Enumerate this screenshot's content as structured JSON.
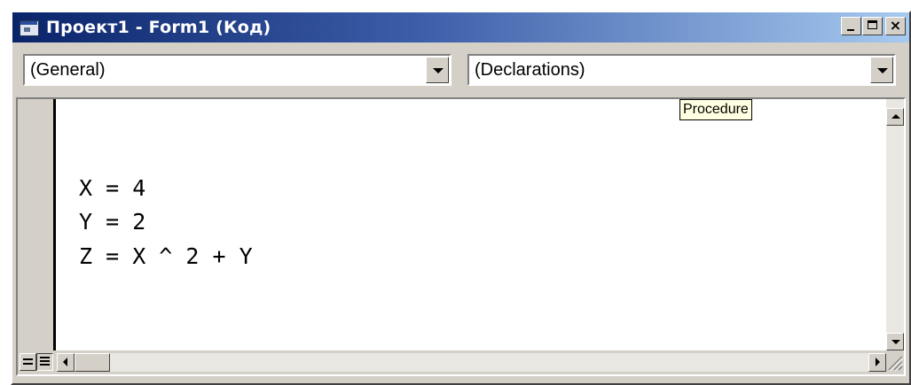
{
  "window": {
    "title": "Проект1 - Form1 (Код)",
    "icons": {
      "app": "vb-form-icon",
      "minimize": "minimize-icon",
      "maximize": "maximize-icon",
      "close": "close-icon"
    },
    "close_glyph": "×"
  },
  "toolbar": {
    "object_combo": {
      "value": "(General)"
    },
    "procedure_combo": {
      "value": "(Declarations)"
    }
  },
  "tooltip": {
    "text": "Procedure"
  },
  "code": {
    "lines": [
      "X = 4",
      "Y = 2",
      "Z = X ^ 2 + Y"
    ]
  },
  "colors": {
    "title_gradient_start": "#0a246a",
    "title_gradient_end": "#a6caf0",
    "face": "#d4d0c8",
    "tooltip_bg": "#ffffe1"
  }
}
